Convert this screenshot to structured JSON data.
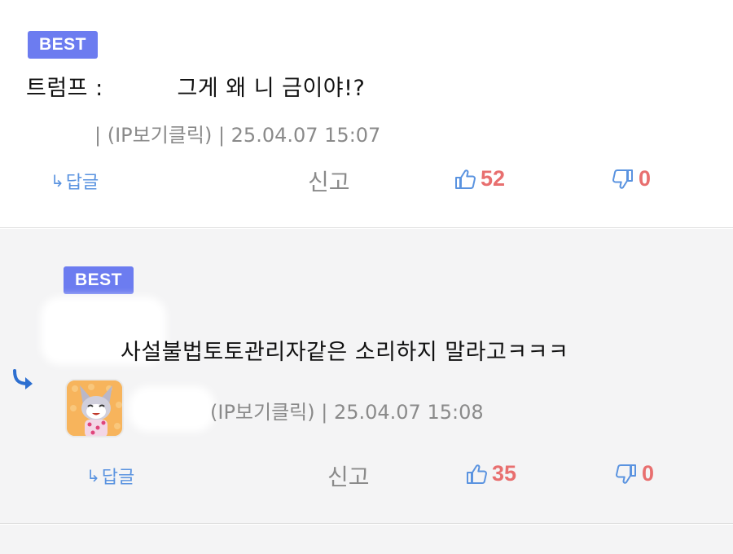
{
  "comments": [
    {
      "badge": "BEST",
      "text": "트럼프 :          그게 왜 니 금이야!?",
      "meta": "| (IP보기클릭) | 25.04.07 15:07",
      "reply_label": "답글",
      "report_label": "신고",
      "likes": "52",
      "dislikes": "0"
    },
    {
      "badge": "BEST",
      "text": "사설불법토토관리자같은 소리하지 말라고ㅋㅋㅋ",
      "meta": "(IP보기클릭) | 25.04.07 15:08",
      "reply_label": "답글",
      "report_label": "신고",
      "likes": "35",
      "dislikes": "0"
    }
  ],
  "icons": {
    "reply_arrow": "reply-arrow-icon",
    "like": "thumbs-up-icon",
    "dislike": "thumbs-down-icon",
    "nested_reply": "curved-reply-arrow-icon"
  },
  "colors": {
    "badge": "#6c7cf0",
    "accent_blue": "#5a93e0",
    "count_red": "#e86f6f",
    "meta_gray": "#8a8a8a",
    "reply_bg": "#f4f4f5"
  }
}
